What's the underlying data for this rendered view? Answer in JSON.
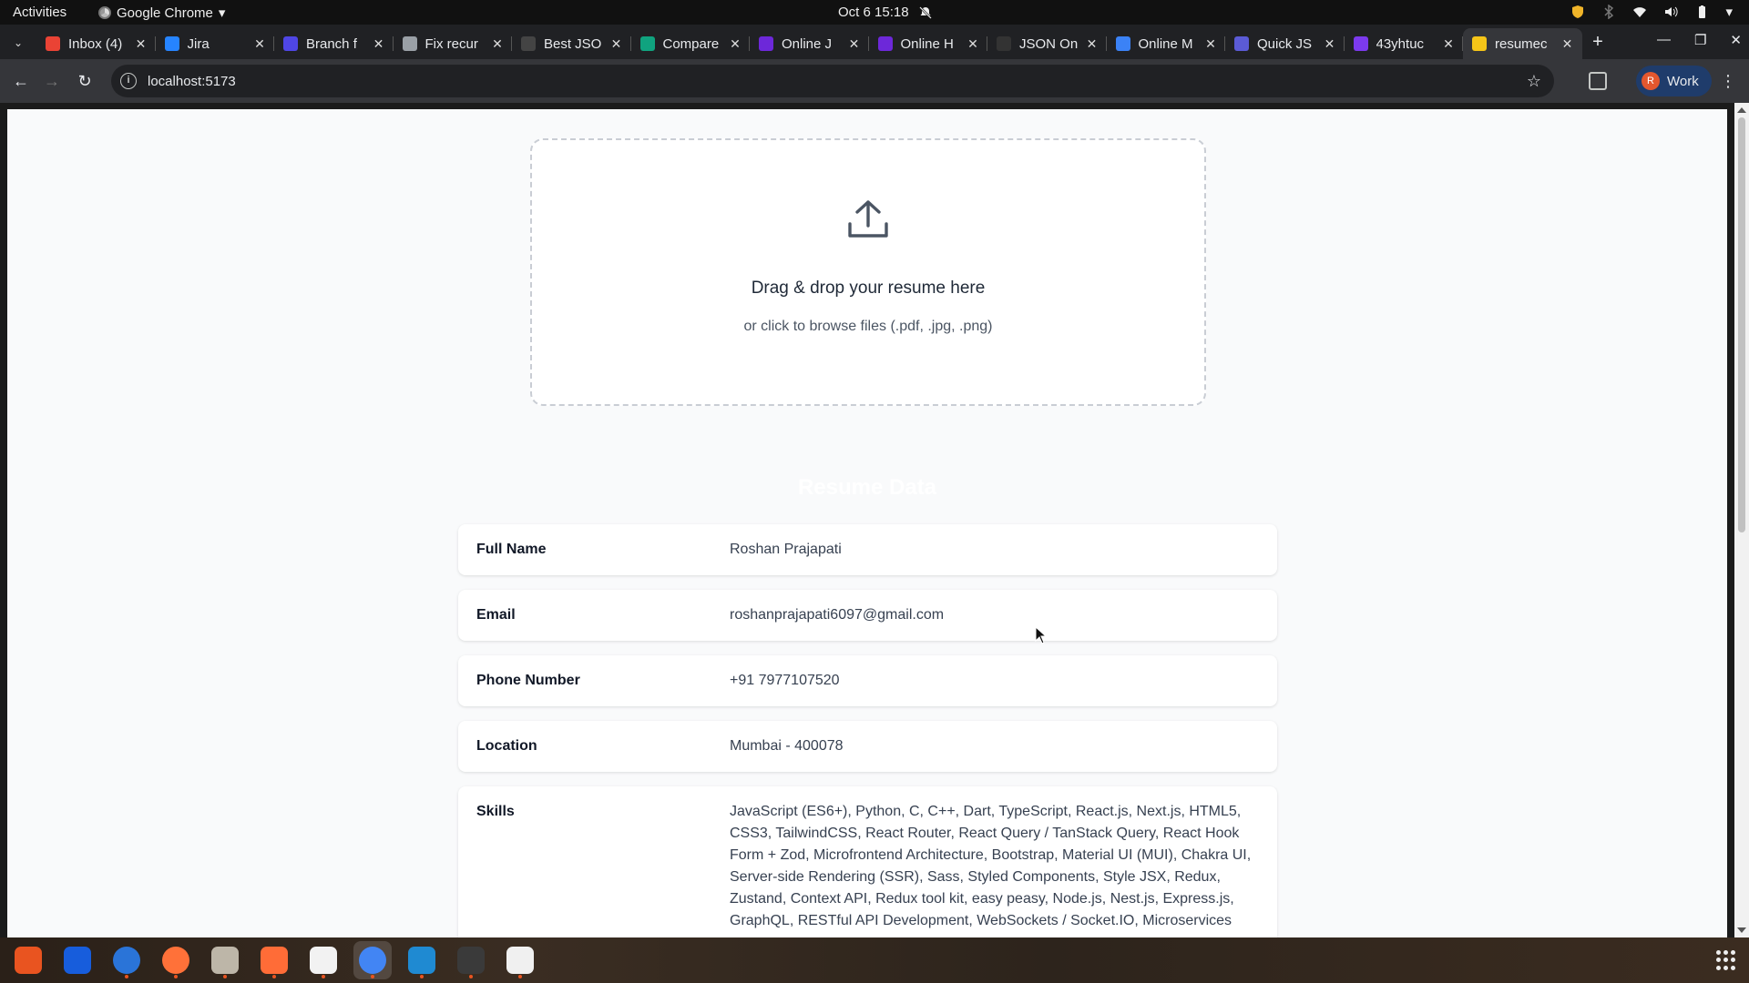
{
  "system": {
    "activities": "Activities",
    "app_name": "Google Chrome",
    "clock": "Oct 6  15:18"
  },
  "tabs": [
    {
      "label": "Inbox (4)",
      "color": "#ea4335"
    },
    {
      "label": "Jira",
      "color": "#2684ff"
    },
    {
      "label": "Branch f",
      "color": "#4f46e5"
    },
    {
      "label": "Fix recur",
      "color": "#9aa0a6"
    },
    {
      "label": "Best JSO",
      "color": "#444444"
    },
    {
      "label": "Compare",
      "color": "#10a37f"
    },
    {
      "label": "Online J",
      "color": "#6d28d9"
    },
    {
      "label": "Online H",
      "color": "#6d28d9"
    },
    {
      "label": "JSON On",
      "color": "#333333"
    },
    {
      "label": "Online M",
      "color": "#3b82f6"
    },
    {
      "label": "Quick JS",
      "color": "#5b5bd6"
    },
    {
      "label": "43yhtuc",
      "color": "#7c3aed"
    },
    {
      "label": "resumec",
      "color": "#f5c518"
    }
  ],
  "address_bar": {
    "url": "localhost:5173"
  },
  "profile": {
    "initial": "R",
    "label": "Work"
  },
  "dropzone": {
    "title": "Drag & drop your resume here",
    "subtitle": "or click to browse files (.pdf, .jpg, .png)"
  },
  "section_title": "Resume Data",
  "fields": [
    {
      "key": "Full Name",
      "value": "Roshan Prajapati"
    },
    {
      "key": "Email",
      "value": "roshanprajapati6097@gmail.com"
    },
    {
      "key": "Phone Number",
      "value": "+91 7977107520"
    },
    {
      "key": "Location",
      "value": "Mumbai - 400078"
    },
    {
      "key": "Skills",
      "value": "JavaScript (ES6+), Python, C, C++, Dart, TypeScript, React.js, Next.js, HTML5, CSS3, TailwindCSS, React Router, React Query / TanStack Query, React Hook Form + Zod, Microfrontend Architecture, Bootstrap, Material UI (MUI), Chakra UI, Server-side Rendering (SSR), Sass, Styled Components, Style JSX, Redux, Zustand, Context API, Redux tool kit, easy peasy, Node.js, Nest.js, Express.js, GraphQL, RESTful API Development, WebSockets / Socket.IO, Microservices"
    }
  ],
  "dock": [
    {
      "name": "app-center",
      "color": "#e95420"
    },
    {
      "name": "bitwarden",
      "color": "#175ddc"
    },
    {
      "name": "thunderbird",
      "color": "#2a74d8"
    },
    {
      "name": "firefox",
      "color": "#ff7139"
    },
    {
      "name": "files",
      "color": "#bdb6a8"
    },
    {
      "name": "postman",
      "color": "#ff6c37"
    },
    {
      "name": "inkscape",
      "color": "#f2f2f2"
    },
    {
      "name": "chrome",
      "color": "#4285f4"
    },
    {
      "name": "vscode",
      "color": "#1f8ad2"
    },
    {
      "name": "terminal",
      "color": "#3a3a3a"
    },
    {
      "name": "text-editor",
      "color": "#f0f0f0"
    }
  ]
}
